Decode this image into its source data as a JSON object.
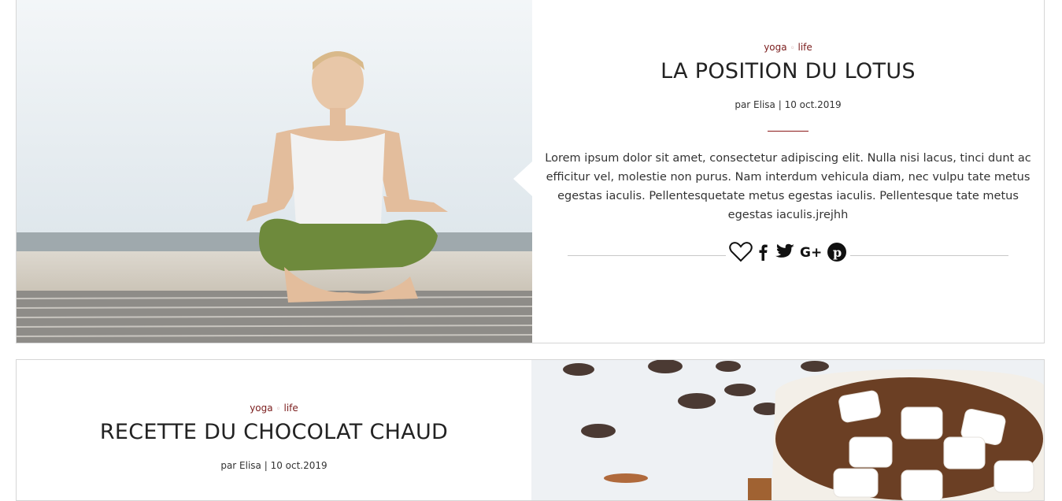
{
  "posts": [
    {
      "categories": [
        "yoga",
        "life"
      ],
      "title": "LA POSITION DU LOTUS",
      "author_prefix": "par",
      "author": "Elisa",
      "date": "10 oct.2019",
      "meta": "par Elisa | 10 oct.2019",
      "excerpt": "Lorem ipsum dolor sit amet, consectetur adipiscing elit. Nulla nisi lacus, tinci dunt ac efficitur vel, molestie non purus. Nam interdum vehicula diam, nec vulpu tate metus egestas iaculis. Pellentesquetate metus egestas iaculis. Pellentesque tate metus egestas iaculis.jrejhh",
      "share_icons": [
        "heart-icon",
        "facebook-icon",
        "twitter-icon",
        "google-plus-icon",
        "pinterest-icon"
      ]
    },
    {
      "categories": [
        "yoga",
        "life"
      ],
      "title": "RECETTE DU CHOCOLAT CHAUD",
      "meta": "par Elisa | 10 oct.2019"
    }
  ],
  "colors": {
    "accent": "#7a1c1c",
    "divider": "#8b1a1a",
    "text": "#222222",
    "border": "#d6d6d6"
  }
}
